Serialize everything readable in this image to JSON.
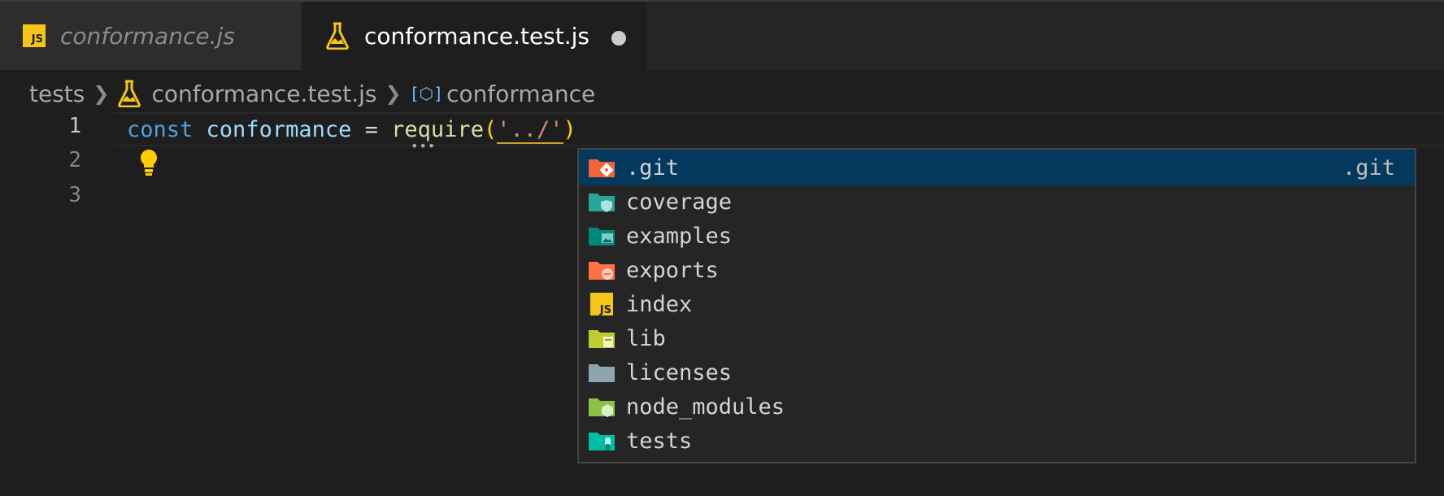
{
  "tabs": [
    {
      "label": "conformance.js",
      "icon": "js-file-icon",
      "active": false
    },
    {
      "label": "conformance.test.js",
      "icon": "flask-icon",
      "active": true,
      "dirty": true
    }
  ],
  "breadcrumb": {
    "folder": "tests",
    "file": "conformance.test.js",
    "symbol": "conformance"
  },
  "editor": {
    "line_numbers": [
      "1",
      "2",
      "3"
    ],
    "line1": {
      "keyword": "const",
      "variable": "conformance",
      "operator": "=",
      "function": "require",
      "open_paren": "(",
      "string": "'../'",
      "close_paren": ")"
    },
    "lightbulb_icon": "lightbulb-icon"
  },
  "suggestions": {
    "items": [
      {
        "label": ".git",
        "detail": ".git",
        "icon": "folder-git-icon",
        "color": "#f4623a",
        "selected": true
      },
      {
        "label": "coverage",
        "icon": "folder-coverage-icon",
        "color": "#26a69a"
      },
      {
        "label": "examples",
        "icon": "folder-examples-icon",
        "color": "#00897b"
      },
      {
        "label": "exports",
        "icon": "folder-exports-icon",
        "color": "#ff7043"
      },
      {
        "label": "index",
        "icon": "js-file-icon",
        "color": "#f5c518"
      },
      {
        "label": "lib",
        "icon": "folder-lib-icon",
        "color": "#c0ca33"
      },
      {
        "label": "licenses",
        "icon": "folder-icon",
        "color": "#90a4ae"
      },
      {
        "label": "node_modules",
        "icon": "folder-node-icon",
        "color": "#8bc34a"
      },
      {
        "label": "tests",
        "icon": "folder-test-icon",
        "color": "#00bfa5"
      }
    ]
  },
  "colors": {
    "selected_background": "#04395e",
    "editor_background": "#1e1e1e"
  }
}
